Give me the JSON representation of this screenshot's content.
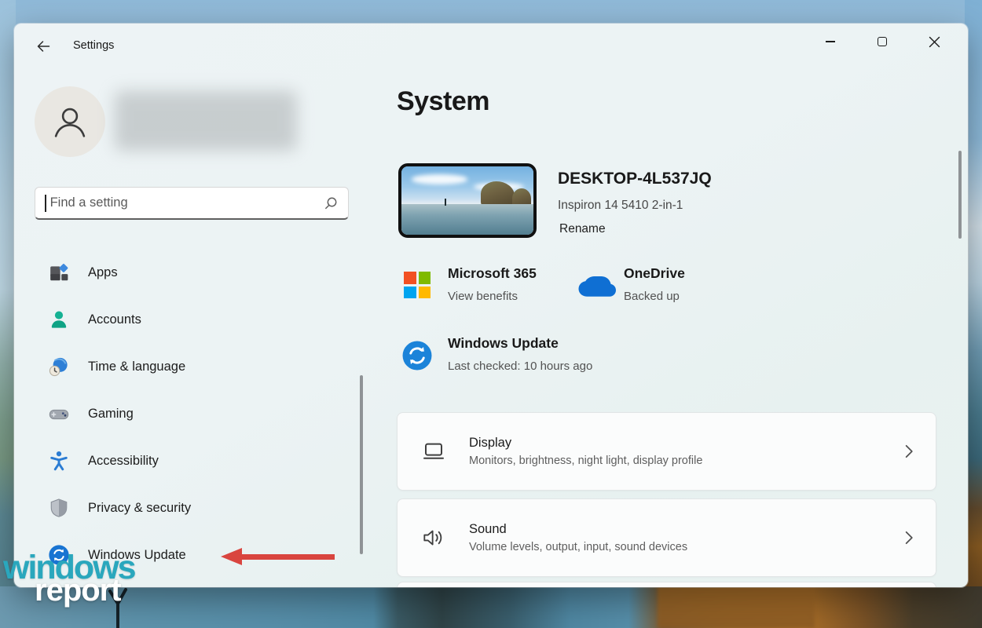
{
  "window": {
    "title_bar": {
      "title": "Settings"
    },
    "page_title": "System"
  },
  "sidebar": {
    "search": {
      "placeholder": "Find a setting"
    },
    "items": [
      {
        "label": "Apps"
      },
      {
        "label": "Accounts"
      },
      {
        "label": "Time & language"
      },
      {
        "label": "Gaming"
      },
      {
        "label": "Accessibility"
      },
      {
        "label": "Privacy & security"
      },
      {
        "label": "Windows Update"
      }
    ]
  },
  "main": {
    "device": {
      "name": "DESKTOP-4L537JQ",
      "model": "Inspiron 14 5410 2-in-1",
      "rename_label": "Rename"
    },
    "quick_info": [
      {
        "title": "Microsoft 365",
        "subtitle": "View benefits"
      },
      {
        "title": "OneDrive",
        "subtitle": "Backed up"
      },
      {
        "title": "Windows Update",
        "subtitle": "Last checked: 10 hours ago"
      }
    ],
    "cards": [
      {
        "title": "Display",
        "subtitle": "Monitors, brightness, night light, display profile"
      },
      {
        "title": "Sound",
        "subtitle": "Volume levels, output, input, sound devices"
      }
    ]
  },
  "watermark": {
    "line1": "windows",
    "line2": "report"
  },
  "colors": {
    "accent_blue": "#1873d3",
    "arrow_red": "#d9453f",
    "ms_red": "#f25022",
    "ms_green": "#7fba00",
    "ms_blue": "#00a4ef",
    "ms_yellow": "#ffb900",
    "onedrive_blue": "#0f6fd3",
    "watermark_teal": "#2aa7bd"
  }
}
